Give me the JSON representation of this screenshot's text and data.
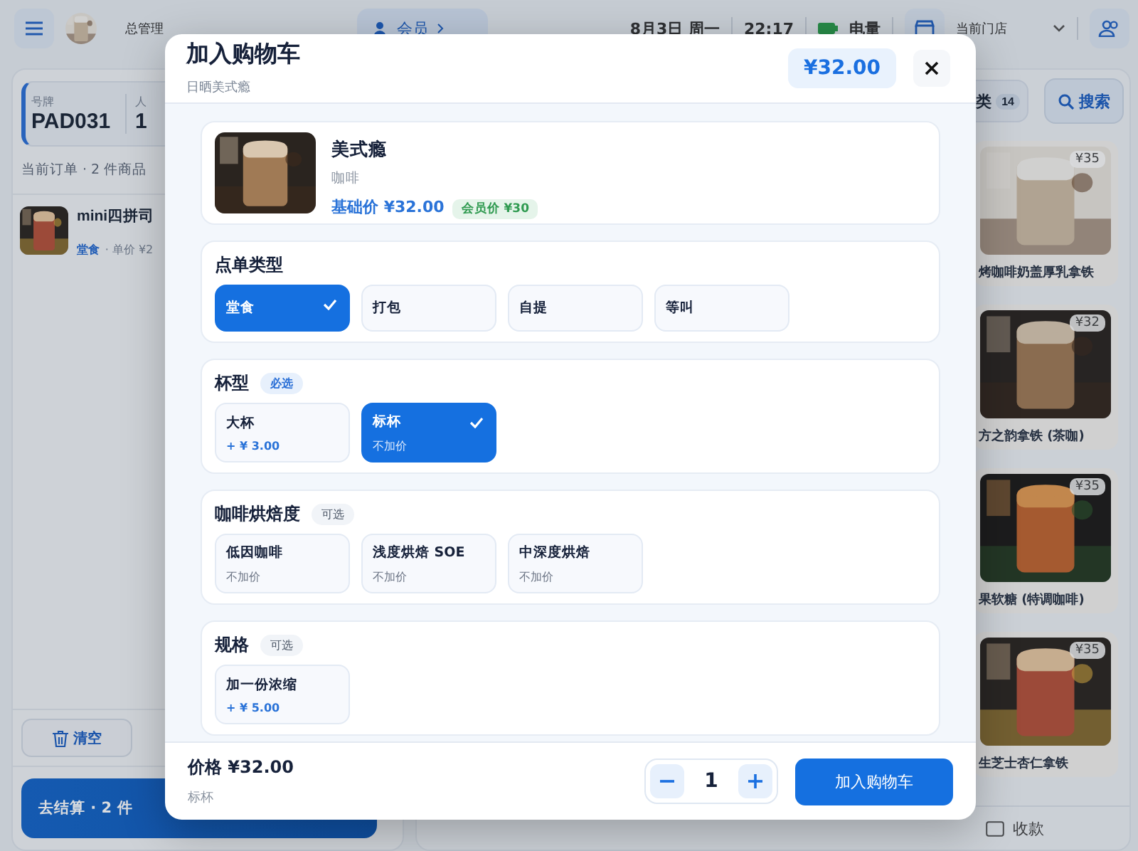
{
  "header": {
    "user_name": "总管理",
    "member_button": "会员",
    "date": "8月3日 周一",
    "time": "22:17",
    "battery_label": "电量",
    "store_label": "当前门店"
  },
  "order": {
    "plate_label": "号牌",
    "plate": "PAD031",
    "people_label": "人",
    "people_value": "1",
    "summary": "当前订单 · 2 件商品",
    "items": [
      {
        "name": "mini四拼司",
        "tag": "堂食",
        "price": "· 单价 ¥2"
      }
    ],
    "clear_button": "清空",
    "checkout_button": "去结算 · 2 件"
  },
  "menu": {
    "category_label": "类",
    "category_count": "14",
    "search_button": "搜索",
    "products": [
      {
        "price": "¥35",
        "name": "烤咖啡奶盖厚乳拿铁"
      },
      {
        "price": "¥32",
        "name": "方之韵拿铁 (茶咖)"
      },
      {
        "price": "¥35",
        "name": "果软糖 (特调咖啡)"
      },
      {
        "price": "¥35",
        "name": "生芝士杏仁拿铁"
      }
    ]
  },
  "bottom_bar": {
    "payment_label": "收款"
  },
  "modal": {
    "title": "加入购物车",
    "subtitle": "日晒美式瘾",
    "price": "¥32.00",
    "product": {
      "name": "美式瘾",
      "category": "咖啡",
      "base_price": "基础价 ¥32.00",
      "member_price": "会员价 ¥30"
    },
    "groups": [
      {
        "title": "点单类型",
        "options": [
          {
            "label": "堂食",
            "selected": true
          },
          {
            "label": "打包",
            "selected": false
          },
          {
            "label": "自提",
            "selected": false
          },
          {
            "label": "等叫",
            "selected": false
          }
        ]
      },
      {
        "title": "杯型",
        "tag": {
          "kind": "required",
          "label": "必选"
        },
        "options": [
          {
            "label": "大杯",
            "note": "+ ¥ 3.00",
            "surcharge": true,
            "selected": false
          },
          {
            "label": "标杯",
            "note": "不加价",
            "surcharge": false,
            "selected": true
          }
        ]
      },
      {
        "title": "咖啡烘焙度",
        "tag": {
          "kind": "optional",
          "label": "可选"
        },
        "options": [
          {
            "label": "低因咖啡",
            "note": "不加价",
            "surcharge": false,
            "selected": false
          },
          {
            "label": "浅度烘焙 SOE",
            "note": "不加价",
            "surcharge": false,
            "selected": false
          },
          {
            "label": "中深度烘焙",
            "note": "不加价",
            "surcharge": false,
            "selected": false
          }
        ]
      },
      {
        "title": "规格",
        "tag": {
          "kind": "optional",
          "label": "可选"
        },
        "options": [
          {
            "label": "加一份浓缩",
            "note": "+ ¥ 5.00",
            "surcharge": true,
            "selected": false
          }
        ]
      }
    ],
    "footer": {
      "price": "价格 ¥32.00",
      "selection": "标杯",
      "quantity": "1",
      "add_button": "加入购物车"
    }
  }
}
